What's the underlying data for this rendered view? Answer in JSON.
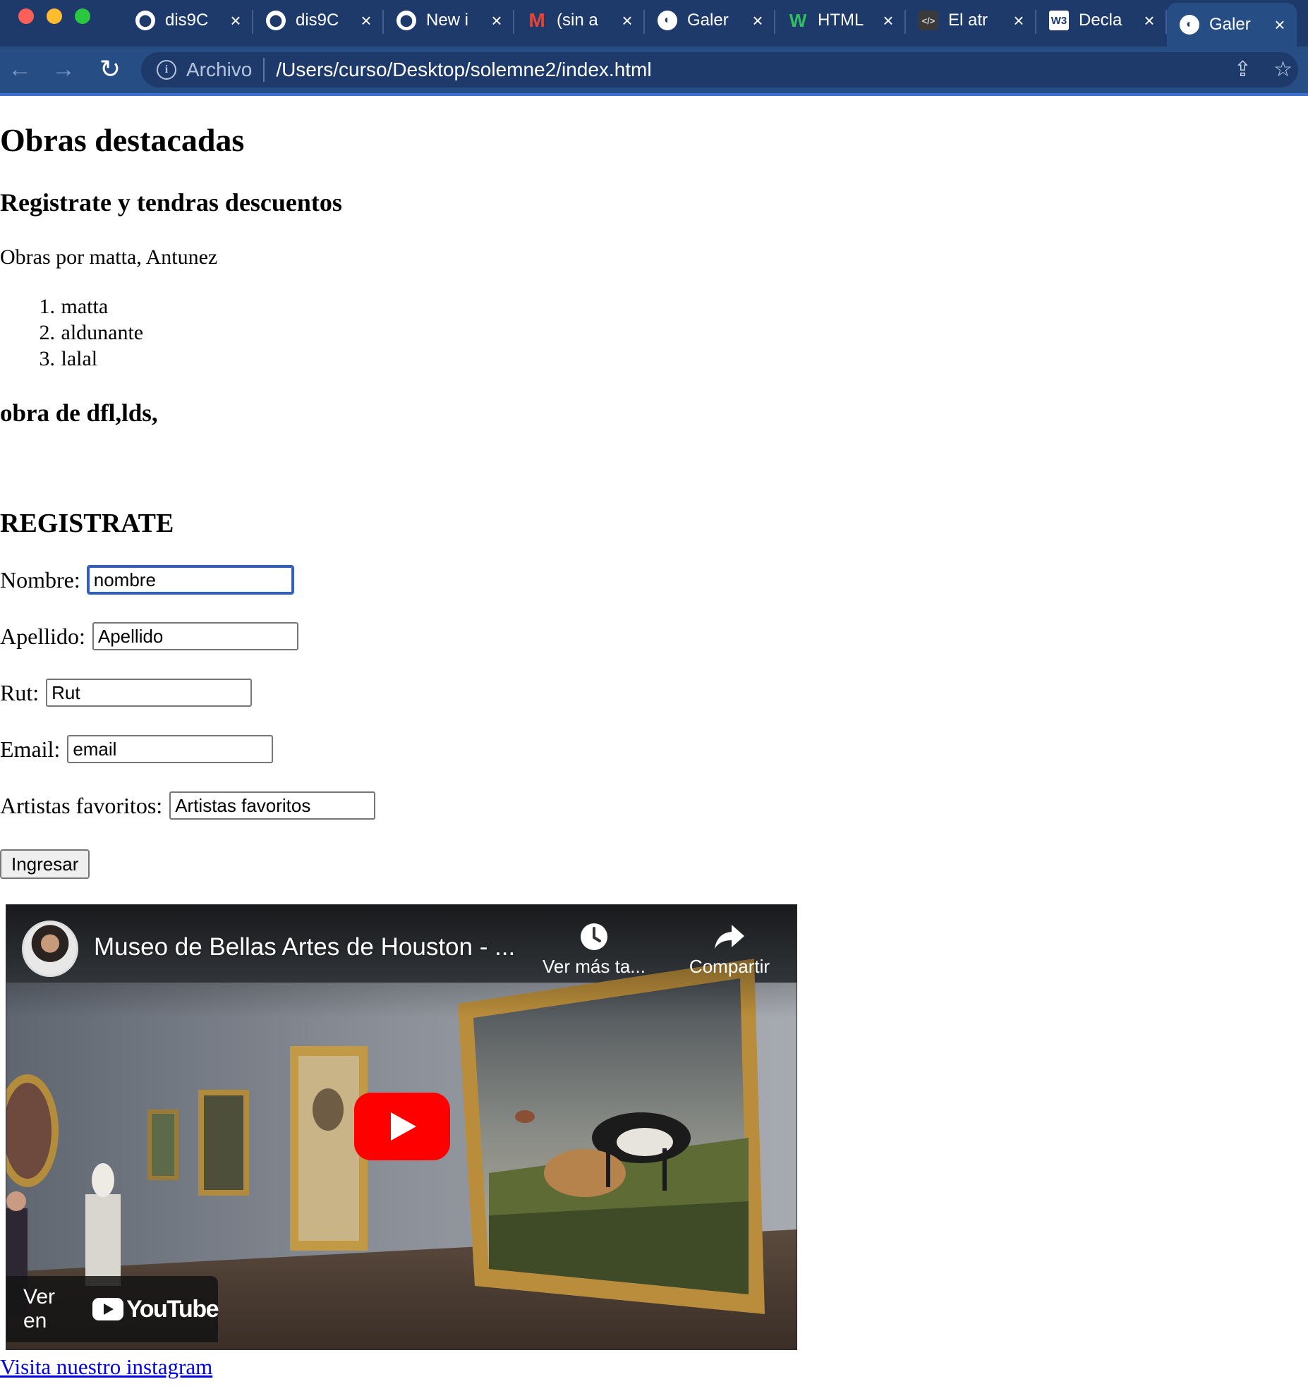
{
  "browser": {
    "tabs": [
      {
        "icon": "github-icon",
        "glyph": "⬤",
        "title": "dis9C"
      },
      {
        "icon": "github-icon",
        "glyph": "⬤",
        "title": "dis9C"
      },
      {
        "icon": "github-icon",
        "glyph": "⬤",
        "title": "New i"
      },
      {
        "icon": "gmail-icon",
        "glyph": "M",
        "title": "(sin a"
      },
      {
        "icon": "globe-icon",
        "glyph": "◐",
        "title": "Galer"
      },
      {
        "icon": "wix-icon",
        "glyph": "W",
        "title": "HTML"
      },
      {
        "icon": "code-icon",
        "glyph": "</>",
        "title": "El atr"
      },
      {
        "icon": "w3schools-icon",
        "glyph": "W3",
        "title": "Decla"
      },
      {
        "icon": "globe-icon",
        "glyph": "◐",
        "title": "Galer"
      }
    ],
    "active_tab_index": 8,
    "address": {
      "scheme_label": "Archivo",
      "url": "/Users/curso/Desktop/solemne2/index.html"
    }
  },
  "page": {
    "heading": "Obras destacadas",
    "subheading": "Registrate y tendras descuentos",
    "intro": "Obras por matta, Antunez",
    "artists": [
      {
        "num": "1.",
        "name": "matta"
      },
      {
        "num": "2.",
        "name": "aldunante"
      },
      {
        "num": "3.",
        "name": "lalal"
      }
    ],
    "obra_heading": "obra de dfl,lds,",
    "register_heading": "REGISTRATE",
    "form": {
      "nombre": {
        "label": "Nombre:",
        "value": "nombre"
      },
      "apellido": {
        "label": "Apellido:",
        "value": "Apellido"
      },
      "rut": {
        "label": "Rut:",
        "value": "Rut"
      },
      "email": {
        "label": "Email:",
        "value": "email"
      },
      "artistas": {
        "label": "Artistas favoritos:",
        "value": "Artistas favoritos"
      },
      "submit_label": "Ingresar"
    },
    "video": {
      "title": "Museo de Bellas Artes de Houston - ...",
      "watch_later": "Ver más ta...",
      "share": "Compartir",
      "watch_on": "Ver en",
      "youtube_word": "YouTube"
    },
    "instagram_link": "Visita nuestro instagram"
  }
}
